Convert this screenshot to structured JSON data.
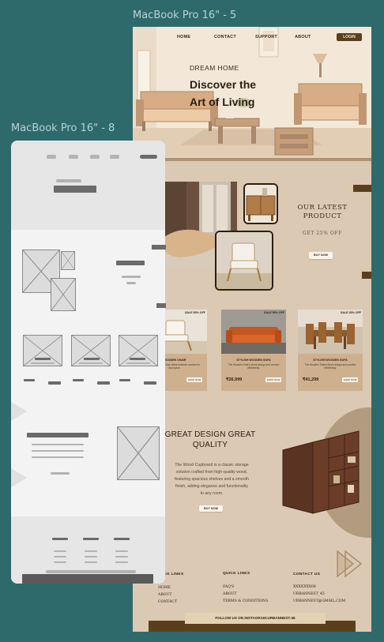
{
  "frames": {
    "desktop_title": "MacBook Pro 16\" - 5",
    "wireframe_title": "MacBook Pro 16\" - 8"
  },
  "nav": {
    "links": [
      "HOME",
      "CONTACT",
      "SUPPORT",
      "ABOUT"
    ],
    "login": "LOGIN"
  },
  "hero": {
    "kicker": "DREAM HOME",
    "title_line1": "Discover the",
    "title_line2": "Art of Living"
  },
  "latest": {
    "title_line1": "OUR LATEST",
    "title_line2": "PRODUCT",
    "subtitle": "GET 25% OFF",
    "button": "BUY NOW"
  },
  "products": [
    {
      "badge": "SALE 50% OFF",
      "name": "WOODEN CHAIR",
      "desc": "The Wooden Chair offers timeless comfort for any space.",
      "price": "",
      "button": "SHOP NOW"
    },
    {
      "badge": "SALE 50% OFF",
      "name": "STYLISH WOODEN SOFA",
      "desc": "The Wooden Sofa's Sleek design and comfort effortlessly.",
      "price": "₹26,999",
      "button": "SHOP NOW"
    },
    {
      "badge": "SALE 30% OFF",
      "name": "STYLISH WOODEN SOFA",
      "desc": "The Wooden Sofa's Sleek design and comfort effortlessly.",
      "price": "₹41,299",
      "button": "SHOP NOW"
    }
  ],
  "great_design": {
    "title_line1": "GREAT DESIGN GREAT",
    "title_line2": "QUALITY",
    "body_lines": [
      "The Wood Cupboard is a classic storage",
      "solution crafted from high-quality wood,",
      "featuring spacious shelves and a smooth",
      "finish, adding elegance and functionality",
      "to any room."
    ],
    "button": "BUY NOW"
  },
  "footer": {
    "quick_links_1": {
      "title": "QUICK LINKS",
      "items": [
        "HOME",
        "ABOUT",
        "CONTACT"
      ]
    },
    "quick_links_2": {
      "title": "QUICK LINKS",
      "items": [
        "FAQ'S",
        "ABOUT",
        "TERMS & CONDITIONS"
      ]
    },
    "contact": {
      "title": "CONTACT US",
      "items": [
        "XXXXXXX08",
        "URBANNEST_45",
        "URBANNEST@GMAIL.COM"
      ]
    },
    "instagram": "FOLLOW US ON INSTAGRAM:URBANNEST-45"
  },
  "colors": {
    "canvas": "#2e6a6c",
    "page_bg": "#dcc9b4",
    "accent_brown": "#5a3f1e",
    "wireframe_bg": "#f3f3f3"
  }
}
